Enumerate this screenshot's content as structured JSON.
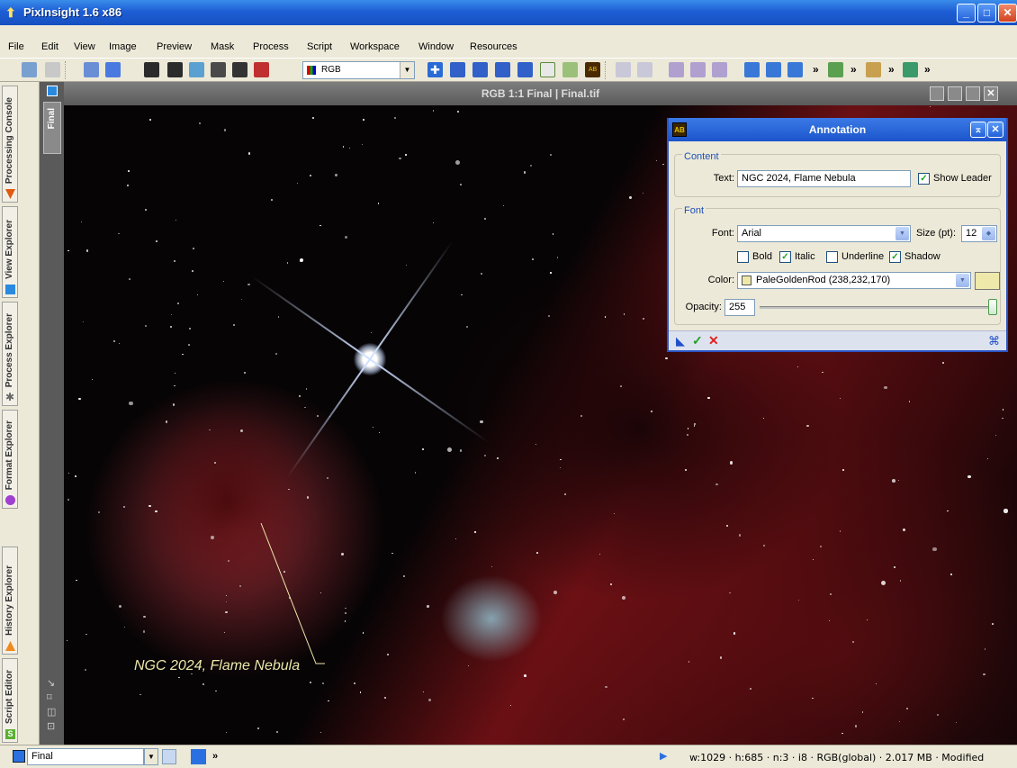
{
  "app": {
    "title": "PixInsight 1.6 x86"
  },
  "menu": [
    "File",
    "Edit",
    "View",
    "Image",
    "Preview",
    "Mask",
    "Process",
    "Script",
    "Workspace",
    "Window",
    "Resources"
  ],
  "toolbar": {
    "channel_select": "RGB",
    "overflow": "»"
  },
  "sidebar": [
    "Processing Console",
    "View Explorer",
    "Process Explorer",
    "Format Explorer",
    "History Explorer",
    "Script Editor"
  ],
  "image_window": {
    "title": "RGB 1:1 Final | Final.tif",
    "view_tab": "Final",
    "annotation_text": "NGC 2024, Flame Nebula"
  },
  "annotation_dialog": {
    "title": "Annotation",
    "content": {
      "group": "Content",
      "text_label": "Text:",
      "text_value": "NGC 2024, Flame Nebula",
      "show_leader_label": "Show Leader",
      "show_leader": true
    },
    "font": {
      "group": "Font",
      "font_label": "Font:",
      "font_value": "Arial",
      "size_label": "Size (pt):",
      "size_value": "12",
      "bold_label": "Bold",
      "bold": false,
      "italic_label": "Italic",
      "italic": true,
      "underline_label": "Underline",
      "underline": false,
      "shadow_label": "Shadow",
      "shadow": true,
      "color_label": "Color:",
      "color_value": "PaleGoldenRod (238,232,170)",
      "color_hex": "#eee8aa",
      "opacity_label": "Opacity:",
      "opacity_value": "255"
    },
    "icon_text": "AB"
  },
  "statusbar": {
    "view": "Final",
    "overflow": "»",
    "info": "w:1029 · h:685 · n:3 · i8 · RGB(global) · 2.017 MB · Modified"
  }
}
